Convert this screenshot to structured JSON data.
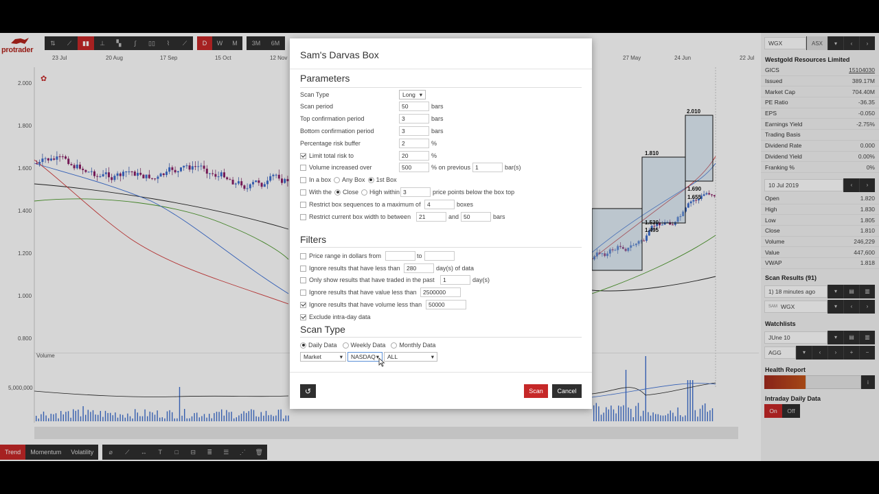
{
  "logo_text": "protrader",
  "toolbar": {
    "chart_tools": [
      "tool",
      "line",
      "candle",
      "bar",
      "ohlc",
      "hl",
      "bar2",
      "line2",
      "area"
    ],
    "periods": [
      "D",
      "W",
      "M"
    ],
    "ranges": [
      "3M",
      "6M"
    ]
  },
  "date_axis": [
    "23 Jul",
    "20 Aug",
    "17 Sep",
    "15 Oct",
    "12 Nov",
    "27 May",
    "24 Jun",
    "22 Jul"
  ],
  "y_axis": [
    "2.000",
    "1.800",
    "1.600",
    "1.400",
    "1.200",
    "1.000",
    "0.800"
  ],
  "volume": {
    "label": "Volume",
    "tick": "5,000,000"
  },
  "box_labels": [
    "2.010",
    "1.810",
    "1.530",
    "1.495",
    "1.690",
    "1.655"
  ],
  "bottom_tabs": [
    "Trend",
    "Momentum",
    "Volatility"
  ],
  "modal": {
    "title": "Sam's Darvas Box",
    "parameters_heading": "Parameters",
    "scan_type_label": "Scan Type",
    "scan_type_value": "Long",
    "scan_period_label": "Scan period",
    "scan_period_value": "50",
    "top_conf_label": "Top confirmation period",
    "top_conf_value": "3",
    "bottom_conf_label": "Bottom confirmation period",
    "bottom_conf_value": "3",
    "risk_buffer_label": "Percentage risk buffer",
    "risk_buffer_value": "2",
    "limit_risk_label": "Limit total risk to",
    "limit_risk_value": "20",
    "volume_inc_label": "Volume increased over",
    "volume_inc_value": "500",
    "volume_inc_unit": "% on previous",
    "volume_inc_bars": "1",
    "volume_inc_unit2": "bar(s)",
    "in_box_label": "In a box",
    "any_box_label": "Any Box",
    "first_box_label": "1st Box",
    "with_the_label": "With the",
    "close_label": "Close",
    "high_within_label": "High within",
    "high_within_value": "3",
    "high_within_unit": "price points below the box top",
    "restrict_seq_label": "Restrict box sequences to a maximum of",
    "restrict_seq_value": "4",
    "restrict_seq_unit": "boxes",
    "restrict_width_label": "Restrict current box width to between",
    "restrict_width_from": "21",
    "restrict_width_and": "and",
    "restrict_width_to": "50",
    "filters_heading": "Filters",
    "price_range_label": "Price range in dollars from",
    "price_range_to": "to",
    "ignore_days_label": "Ignore results that have less than",
    "ignore_days_value": "280",
    "ignore_days_unit": "day(s) of data",
    "traded_label": "Only show results that have traded in the past",
    "traded_value": "1",
    "traded_unit": "day(s)",
    "ignore_value_label": "Ignore results that have value less than",
    "ignore_value_value": "2500000",
    "ignore_volume_label": "Ignore results that have volume less than",
    "ignore_volume_value": "50000",
    "exclude_intraday_label": "Exclude intra-day data",
    "scan_type_heading": "Scan Type",
    "daily_label": "Daily Data",
    "weekly_label": "Weekly Data",
    "monthly_label": "Monthly Data",
    "market_sel": "Market",
    "exchange_sel": "NASDAQ",
    "sector_sel": "ALL",
    "units": {
      "bars": "bars",
      "pct": "%"
    },
    "scan_button": "Scan",
    "cancel_button": "Cancel"
  },
  "right_panel": {
    "symbol": "WGX",
    "exchange": "ASX",
    "company": "Westgold Resources Limited",
    "fundamentals": [
      [
        "GICS",
        "15104030"
      ],
      [
        "Issued",
        "389.17M"
      ],
      [
        "Market Cap",
        "704.40M"
      ],
      [
        "PE Ratio",
        "-36.35"
      ],
      [
        "EPS",
        "-0.050"
      ],
      [
        "Earnings Yield",
        "-2.75%"
      ],
      [
        "Trading Basis",
        ""
      ],
      [
        "Dividend Rate",
        "0.000"
      ],
      [
        "Dividend Yield",
        "0.00%"
      ],
      [
        "Franking %",
        "0%"
      ]
    ],
    "date": "10 Jul 2019",
    "ohlc": [
      [
        "Open",
        "1.820"
      ],
      [
        "High",
        "1.830"
      ],
      [
        "Low",
        "1.805"
      ],
      [
        "Close",
        "1.810"
      ],
      [
        "Volume",
        "246,229"
      ],
      [
        "Value",
        "447,600"
      ],
      [
        "VWAP",
        "1.818"
      ]
    ],
    "scan_results_heading": "Scan Results (91)",
    "scan_results_value": "1) 18 minutes ago",
    "scan_symbol": "WGX",
    "scan_prefix": "SAM",
    "watchlists_heading": "Watchlists",
    "watchlist_value": "JUne 10",
    "watch_symbol": "AGG",
    "health_heading": "Health Report",
    "intraday_heading": "Intraday Daily Data",
    "on_label": "On",
    "off_label": "Off"
  },
  "colors": {
    "accent": "#c62828",
    "dark": "#2f2f2f"
  }
}
